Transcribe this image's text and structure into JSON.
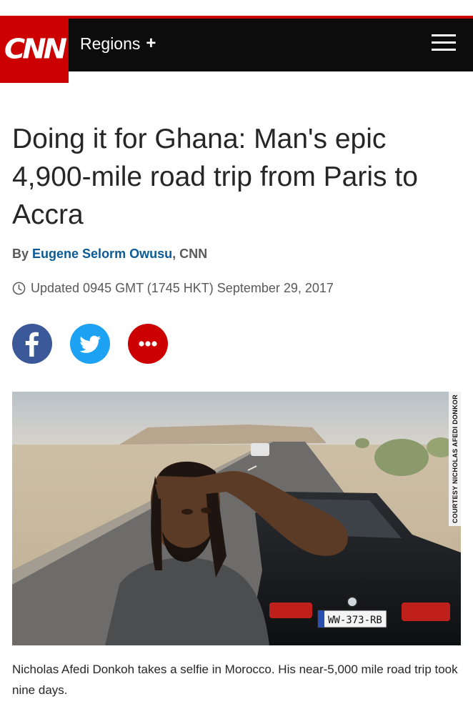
{
  "header": {
    "logo_text": "CNN",
    "regions_label": "Regions",
    "regions_plus": "+",
    "brand_color": "#cc0000",
    "bar_color": "#0c0c0c",
    "menu_icon": "hamburger-menu-icon"
  },
  "article": {
    "headline": "Doing it for Ghana: Man's epic 4,900-mile road trip from Paris to Accra",
    "byline_prefix": "By",
    "author": "Eugene Selorm Owusu",
    "byline_suffix": ", CNN",
    "updated": "Updated 0945 GMT (1745 HKT) September 29, 2017",
    "clock_icon": "clock-icon"
  },
  "share": {
    "facebook_icon": "facebook-icon",
    "twitter_icon": "twitter-icon",
    "more_icon": "more-dots-icon",
    "facebook_color": "#3b5998",
    "twitter_color": "#1da1f2",
    "more_color": "#cc0000"
  },
  "photo": {
    "credit": "COURTESY NICHOLAS AFEDI DONKOR",
    "license_plate": "WW-373-RB",
    "caption": "Nicholas Afedi Donkoh takes a selfie in Morocco. His near-5,000 mile road trip took nine days."
  }
}
